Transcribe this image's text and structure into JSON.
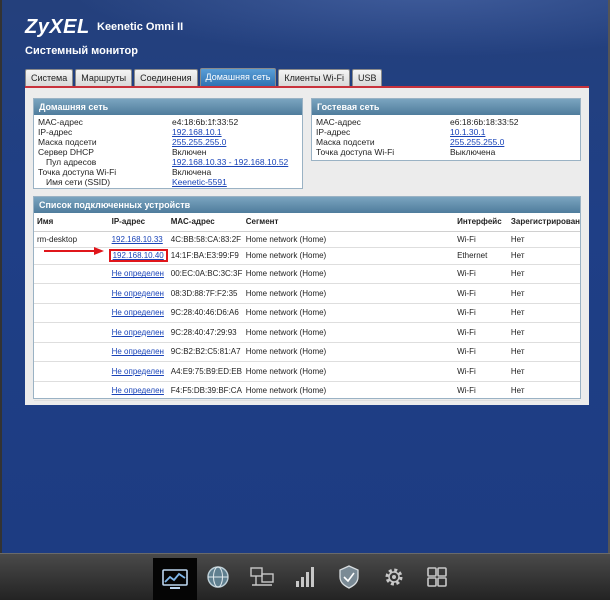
{
  "header": {
    "brand": "ZyXEL",
    "model": "Keenetic Omni II",
    "page_title": "Системный монитор"
  },
  "tabs": [
    {
      "label": "Система",
      "active": false
    },
    {
      "label": "Маршруты",
      "active": false
    },
    {
      "label": "Соединения",
      "active": false
    },
    {
      "label": "Домашняя сеть",
      "active": true
    },
    {
      "label": "Клиенты Wi-Fi",
      "active": false
    },
    {
      "label": "USB",
      "active": false
    }
  ],
  "home_network": {
    "title": "Домашняя сеть",
    "rows": [
      {
        "key": "МАС-адрес",
        "value": "e4:18:6b:1f:33:52",
        "link": false,
        "indent": false
      },
      {
        "key": "IP-адрес",
        "value": "192.168.10.1",
        "link": true,
        "indent": false
      },
      {
        "key": "Маска подсети",
        "value": "255.255.255.0",
        "link": true,
        "indent": false
      },
      {
        "key": "Сервер DHCP",
        "value": "Включен",
        "link": false,
        "indent": false
      },
      {
        "key": "Пул адресов",
        "value": "192.168.10.33 - 192.168.10.52",
        "link": true,
        "indent": true
      },
      {
        "key": "Точка доступа Wi-Fi",
        "value": "Включена",
        "link": false,
        "indent": false
      },
      {
        "key": "Имя сети (SSID)",
        "value": "Keenetic-5591",
        "link": true,
        "indent": true
      }
    ]
  },
  "guest_network": {
    "title": "Гостевая сеть",
    "rows": [
      {
        "key": "МАС-адрес",
        "value": "e6:18:6b:18:33:52",
        "link": false
      },
      {
        "key": "IP-адрес",
        "value": "10.1.30.1",
        "link": true
      },
      {
        "key": "Маска подсети",
        "value": "255.255.255.0",
        "link": true
      },
      {
        "key": "Точка доступа Wi-Fi",
        "value": "Выключена",
        "link": false
      }
    ]
  },
  "devices": {
    "title": "Список подключенных устройств",
    "columns": [
      "Имя",
      "IP-адрес",
      "МАС-адрес",
      "Сегмент",
      "Интерфейс",
      "Зарегистрирован"
    ],
    "rows": [
      {
        "name": "rm-desktop",
        "ip": "192.168.10.33",
        "ip_link": true,
        "mac": "4C:BB:58:CA:83:2F",
        "segment": "Home network (Home)",
        "iface": "Wi-Fi",
        "reg": "Нет",
        "highlight": false
      },
      {
        "name": "",
        "ip": "192.168.10.40",
        "ip_link": true,
        "mac": "14:1F:BA:E3:99:F9",
        "segment": "Home network (Home)",
        "iface": "Ethernet",
        "reg": "Нет",
        "highlight": true
      },
      {
        "name": "",
        "ip": "Не определен",
        "ip_link": true,
        "mac": "00:EC:0A:BC:3C:3F",
        "segment": "Home network (Home)",
        "iface": "Wi-Fi",
        "reg": "Нет",
        "highlight": false
      },
      {
        "name": "",
        "ip": "Не определен",
        "ip_link": true,
        "mac": "08:3D:88:7F:F2:35",
        "segment": "Home network (Home)",
        "iface": "Wi-Fi",
        "reg": "Нет",
        "highlight": false
      },
      {
        "name": "",
        "ip": "Не определен",
        "ip_link": true,
        "mac": "9C:28:40:46:D6:A6",
        "segment": "Home network (Home)",
        "iface": "Wi-Fi",
        "reg": "Нет",
        "highlight": false
      },
      {
        "name": "",
        "ip": "Не определен",
        "ip_link": true,
        "mac": "9C:28:40:47:29:93",
        "segment": "Home network (Home)",
        "iface": "Wi-Fi",
        "reg": "Нет",
        "highlight": false
      },
      {
        "name": "",
        "ip": "Не определен",
        "ip_link": true,
        "mac": "9C:B2:B2:C5:81:A7",
        "segment": "Home network (Home)",
        "iface": "Wi-Fi",
        "reg": "Нет",
        "highlight": false
      },
      {
        "name": "",
        "ip": "Не определен",
        "ip_link": true,
        "mac": "A4:E9:75:B9:ED:EB",
        "segment": "Home network (Home)",
        "iface": "Wi-Fi",
        "reg": "Нет",
        "highlight": false
      },
      {
        "name": "",
        "ip": "Не определен",
        "ip_link": true,
        "mac": "F4:F5:DB:39:BF:CA",
        "segment": "Home network (Home)",
        "iface": "Wi-Fi",
        "reg": "Нет",
        "highlight": false
      }
    ]
  },
  "dock": [
    {
      "icon": "monitor-chart-icon",
      "active": true
    },
    {
      "icon": "globe-icon",
      "active": false
    },
    {
      "icon": "network-computers-icon",
      "active": false
    },
    {
      "icon": "signal-bars-icon",
      "active": false
    },
    {
      "icon": "shield-icon",
      "active": false
    },
    {
      "icon": "gear-icon",
      "active": false
    },
    {
      "icon": "apps-grid-icon",
      "active": false
    }
  ],
  "colors": {
    "background": "#1f3f86",
    "accent_red": "#c8323c",
    "link": "#1a44b8",
    "box_header": "#5f8aa8",
    "highlight_box": "#e0161b"
  }
}
